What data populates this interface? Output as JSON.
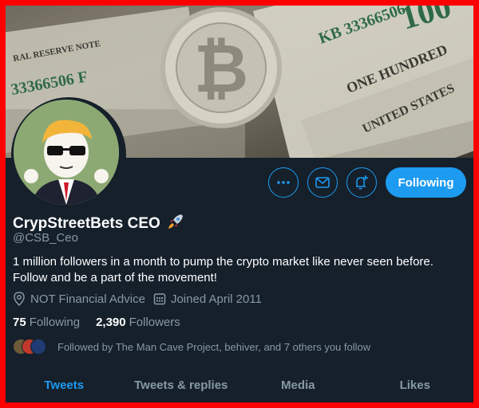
{
  "profile": {
    "display_name": "CrypStreetBets CEO",
    "handle": "@CSB_Ceo",
    "bio_lines": [
      "1 million followers in a month to pump the crypto market like never seen before.",
      "Follow and be a part of the movement!"
    ],
    "location": "NOT Financial Advice",
    "joined": "Joined April 2011",
    "following_count": "75",
    "following_label": "Following",
    "followers_count": "2,390",
    "followers_label": "Followers",
    "followed_by": "Followed by The Man Cave Project, behiver, and 7 others you follow"
  },
  "actions": {
    "more_icon": "more-icon",
    "message_icon": "mail-icon",
    "notify_icon": "bell-plus-icon",
    "follow_label": "Following"
  },
  "banner": {
    "bill_texts": [
      "KB 33366506",
      "33366506 F",
      "ONE HUNDRED",
      "UNITED STATES",
      "RAL RESERVE NOTE",
      "100"
    ]
  },
  "tabs": [
    {
      "label": "Tweets",
      "active": true
    },
    {
      "label": "Tweets & replies",
      "active": false
    },
    {
      "label": "Media",
      "active": false
    },
    {
      "label": "Likes",
      "active": false
    }
  ],
  "colors": {
    "accent": "#1d9bf0",
    "background": "#15202b",
    "muted": "#8899a6",
    "frame": "#ff0000"
  }
}
